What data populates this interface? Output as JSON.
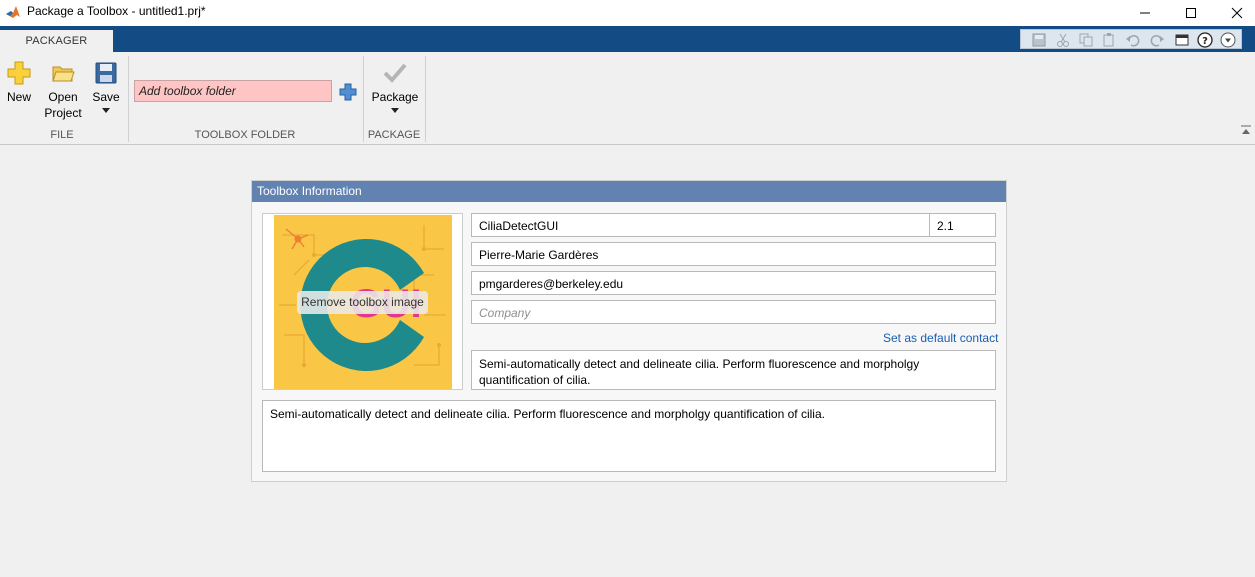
{
  "window": {
    "title": "Package a Toolbox - untitled1.prj*",
    "icon": "matlab-icon",
    "controls": [
      "minimize-icon",
      "maximize-icon",
      "close-icon"
    ]
  },
  "tabs": [
    {
      "label": "PACKAGER",
      "active": true
    }
  ],
  "quick_access_icons": [
    "save-icon",
    "cut-icon",
    "copy-icon",
    "paste-icon",
    "undo-icon",
    "redo-icon",
    "window-layout-icon",
    "help-icon",
    "dropdown-icon"
  ],
  "ribbon": {
    "file_group": {
      "label": "FILE",
      "new_label": "New",
      "open_label_line1": "Open",
      "open_label_line2": "Project",
      "save_label": "Save"
    },
    "toolbox_folder_group": {
      "label": "TOOLBOX FOLDER",
      "input_placeholder": "Add toolbox folder"
    },
    "package_group": {
      "label": "PACKAGE",
      "package_label": "Package"
    }
  },
  "toolbox_info": {
    "header": "Toolbox Information",
    "image_overlay_text": "GUI",
    "remove_image_label": "Remove toolbox image",
    "name": "CiliaDetectGUI",
    "version": "2.1",
    "author": "Pierre-Marie Gardères",
    "email": "pmgarderes@berkeley.edu",
    "company_placeholder": "Company",
    "set_default_contact": "Set as default contact",
    "summary": "Semi-automatically detect and delineate cilia. Perform fluorescence and morpholgy quantification of cilia.",
    "description": "Semi-automatically detect and delineate cilia. Perform fluorescence and morpholgy quantification of cilia."
  },
  "colors": {
    "title_strip": "#134c85",
    "panel_header": "#6283b2",
    "folder_input_error": "#ffc5c5",
    "link": "#1a5fb4",
    "image_bg": "#f9c646",
    "image_logo": "#1e8a8c",
    "image_text": "#e0388a"
  }
}
